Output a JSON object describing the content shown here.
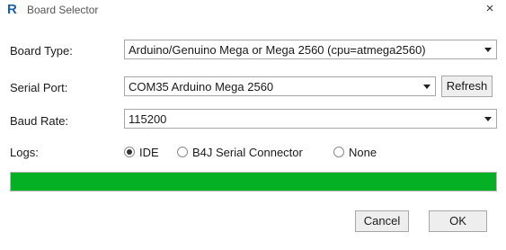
{
  "window": {
    "title": "Board Selector",
    "app_icon_letter": "R",
    "close_glyph": "×"
  },
  "fields": {
    "board_type": {
      "label": "Board Type:",
      "value": "Arduino/Genuino Mega or Mega 2560 (cpu=atmega2560)"
    },
    "serial_port": {
      "label": "Serial Port:",
      "value": "COM35 Arduino Mega 2560",
      "refresh_label": "Refresh"
    },
    "baud_rate": {
      "label": "Baud Rate:",
      "value": "115200"
    },
    "logs": {
      "label": "Logs:",
      "options": [
        {
          "label": "IDE",
          "selected": true
        },
        {
          "label": "B4J Serial Connector",
          "selected": false
        },
        {
          "label": "None",
          "selected": false
        }
      ]
    }
  },
  "progress": {
    "value_percent": 100,
    "color": "#06b025"
  },
  "buttons": {
    "cancel_label": "Cancel",
    "ok_label": "OK"
  }
}
